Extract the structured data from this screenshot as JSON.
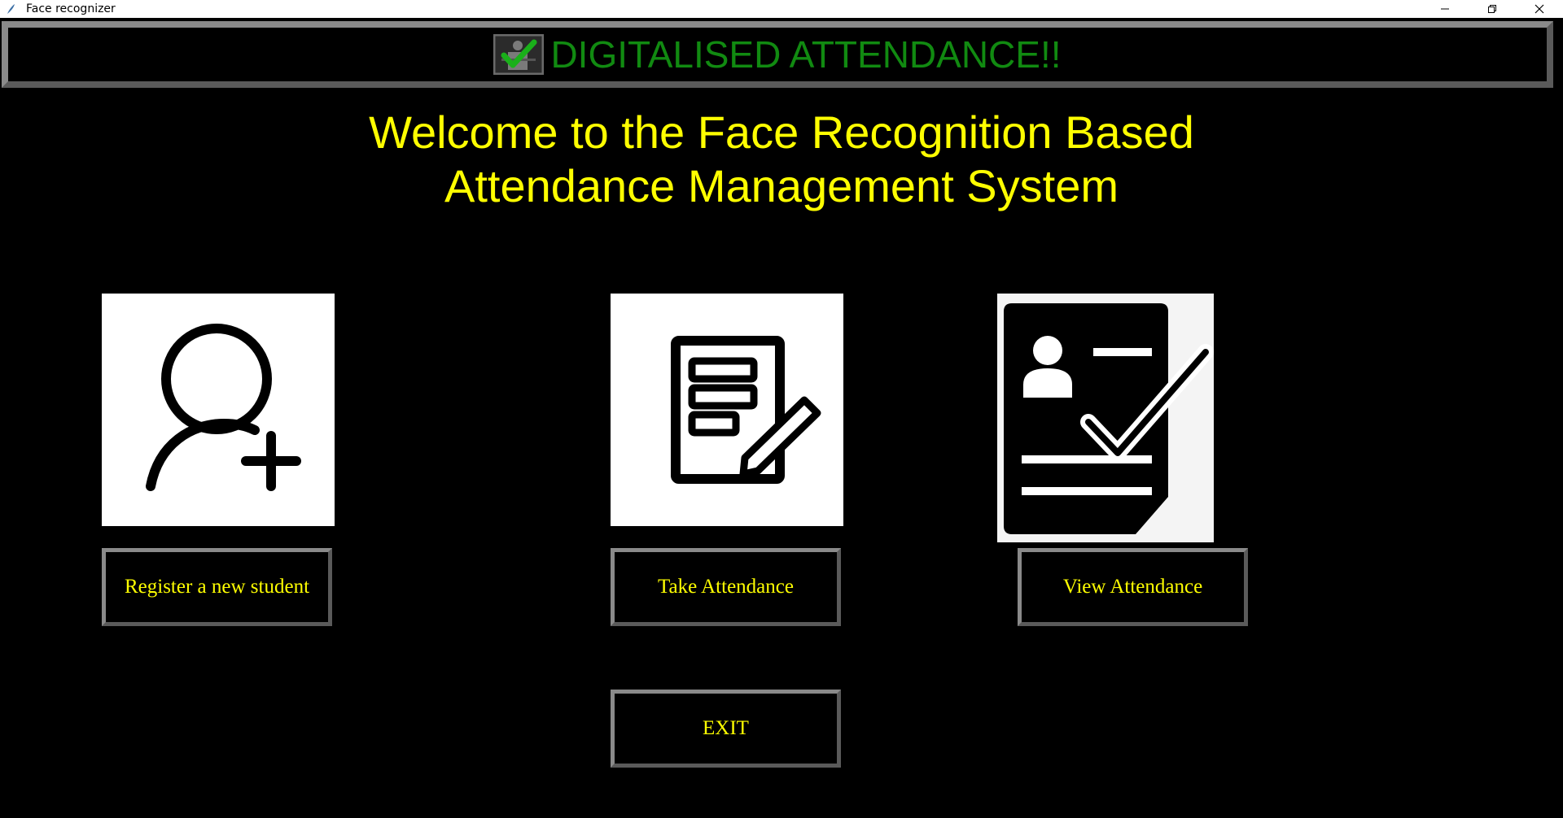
{
  "window": {
    "title": "Face recognizer",
    "controls": [
      "minimize-icon",
      "restore-icon",
      "close-icon"
    ]
  },
  "header": {
    "title": "DIGITALISED ATTENDANCE!!",
    "title_color": "#118a11"
  },
  "welcome": {
    "line1": "Welcome to the Face Recognition Based",
    "line2": "Attendance Management System",
    "color": "#ffff00"
  },
  "actions": {
    "register_label": "Register a new student",
    "take_label": "Take Attendance",
    "view_label": "View Attendance",
    "exit_label": "EXIT"
  },
  "icons": {
    "register": "add-user-icon",
    "take": "form-edit-icon",
    "view": "id-card-check-icon"
  }
}
